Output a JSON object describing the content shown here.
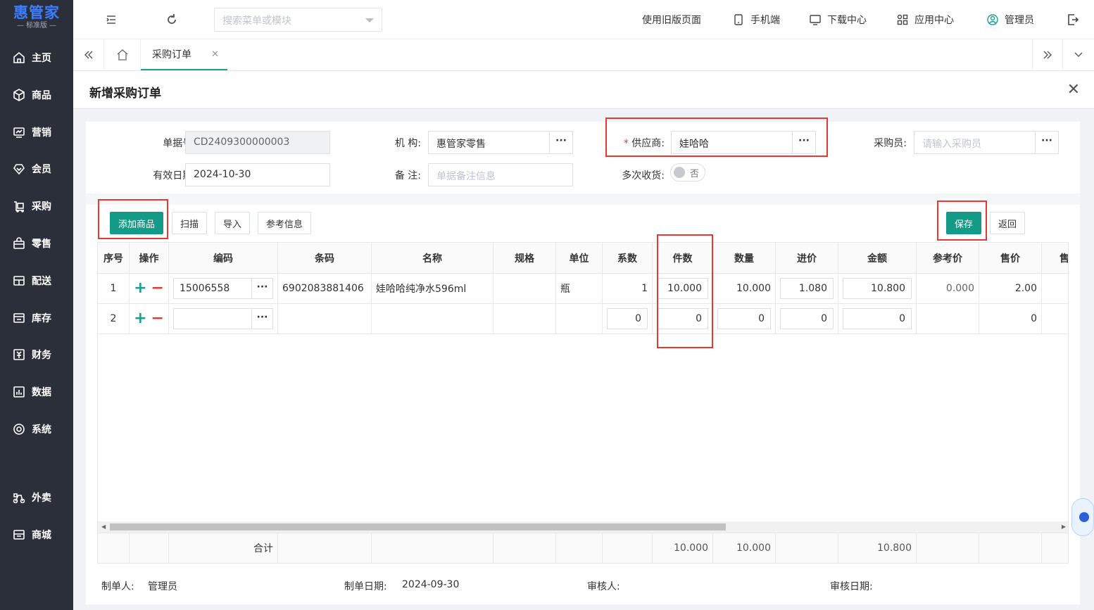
{
  "app": {
    "brand": "惠管家",
    "edition": "— 标准版 —"
  },
  "sidebar": {
    "items": [
      {
        "label": "主页",
        "icon": "home-icon"
      },
      {
        "label": "商品",
        "icon": "box-icon"
      },
      {
        "label": "营销",
        "icon": "marketing-icon"
      },
      {
        "label": "会员",
        "icon": "member-icon"
      },
      {
        "label": "采购",
        "icon": "purchase-icon"
      },
      {
        "label": "零售",
        "icon": "retail-icon"
      },
      {
        "label": "配送",
        "icon": "delivery-icon"
      },
      {
        "label": "库存",
        "icon": "inventory-icon"
      },
      {
        "label": "财务",
        "icon": "finance-icon"
      },
      {
        "label": "数据",
        "icon": "data-icon"
      },
      {
        "label": "系统",
        "icon": "system-icon"
      },
      {
        "label": "外卖",
        "icon": "takeout-icon"
      },
      {
        "label": "商城",
        "icon": "mall-icon"
      }
    ]
  },
  "topbar": {
    "search_placeholder": "搜索菜单或模块",
    "old_version": "使用旧版页面",
    "mobile": "手机端",
    "download": "下载中心",
    "apps": "应用中心",
    "user": "管理员"
  },
  "tabs": {
    "active": "采购订单"
  },
  "page": {
    "title": "新增采购订单"
  },
  "form": {
    "doc_no_label": "单据号:",
    "doc_no": "CD2409300000003",
    "org_label": "机 构:",
    "org": "惠管家零售",
    "required_mark": "*",
    "supplier_label": "供应商:",
    "supplier": "娃哈哈",
    "buyer_label": "采购员:",
    "buyer_placeholder": "请输入采购员",
    "valid_date_label": "有效日期:",
    "valid_date": "2024-10-30",
    "remark_label": "备 注:",
    "remark_placeholder": "单据备注信息",
    "multi_receive_label": "多次收货:",
    "multi_receive_value": "否",
    "dots": "···"
  },
  "toolbar": {
    "add": "添加商品",
    "scan": "扫描",
    "import": "导入",
    "ref": "参考信息",
    "save": "保存",
    "back": "返回"
  },
  "table": {
    "headers": [
      "序号",
      "操作",
      "编码",
      "条码",
      "名称",
      "规格",
      "单位",
      "系数",
      "件数",
      "数量",
      "进价",
      "金额",
      "参考价",
      "售价",
      "售"
    ],
    "rows": [
      {
        "no": "1",
        "code": "15006558",
        "barcode": "6902083881406",
        "name": "娃哈哈纯净水596ml",
        "spec": "",
        "unit": "瓶",
        "coef": "1",
        "pieces": "10.000",
        "qty": "10.000",
        "price": "1.080",
        "amount": "10.800",
        "ref_price": "0.000",
        "sale_price": "2.00"
      },
      {
        "no": "2",
        "code": "",
        "barcode": "",
        "name": "",
        "spec": "",
        "unit": "",
        "coef": "0",
        "pieces": "0",
        "qty": "0",
        "price": "0",
        "amount": "0",
        "ref_price": "",
        "sale_price": "0"
      }
    ],
    "total_label": "合计",
    "total_pieces": "10.000",
    "total_qty": "10.000",
    "total_amount": "10.800",
    "op_plus": "+",
    "op_minus": "−"
  },
  "footer": {
    "maker_label": "制单人:",
    "maker": "管理员",
    "make_date_label": "制单日期:",
    "make_date": "2024-09-30",
    "auditor_label": "审核人:",
    "audit_date_label": "审核日期:"
  }
}
